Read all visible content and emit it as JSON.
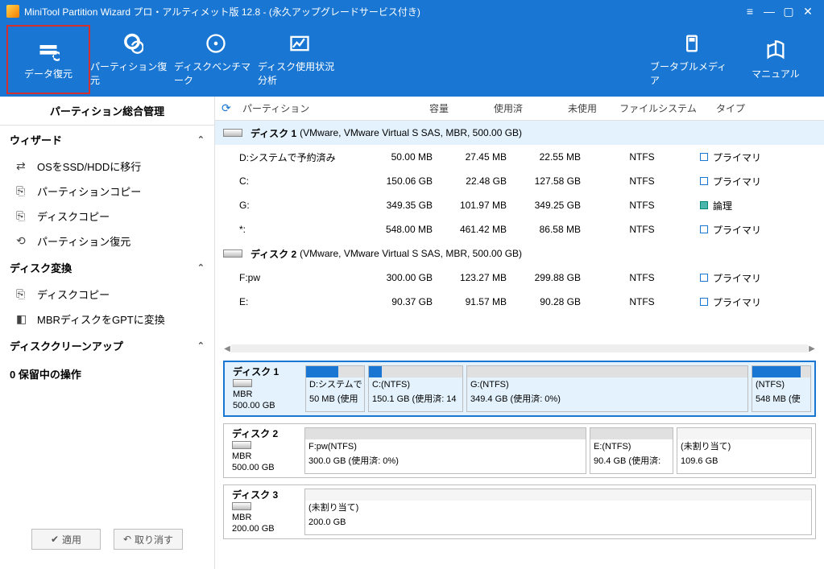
{
  "title": "MiniTool Partition Wizard プロ・アルティメット版 12.8 - (永久アップグレードサービス付き)",
  "ribbon": {
    "data_recovery": "データ復元",
    "partition_recovery": "パーティション復元",
    "disk_benchmark": "ディスクベンチマーク",
    "disk_usage": "ディスク使用状況分析",
    "bootable_media": "ブータブルメディア",
    "manual": "マニュアル"
  },
  "sidebar": {
    "tab": "パーティション総合管理",
    "wizard_head": "ウィザード",
    "wizard": {
      "os_migrate": "OSをSSD/HDDに移行",
      "partition_copy": "パーティションコピー",
      "disk_copy": "ディスクコピー",
      "partition_recovery": "パーティション復元"
    },
    "convert_head": "ディスク変換",
    "convert": {
      "disk_copy": "ディスクコピー",
      "mbr2gpt": "MBRディスクをGPTに変換"
    },
    "cleanup_head": "ディスククリーンアップ",
    "pending": "0 保留中の操作",
    "apply": "適用",
    "undo": "取り消す"
  },
  "columns": {
    "partition": "パーティション",
    "capacity": "容量",
    "used": "使用済",
    "unused": "未使用",
    "filesystem": "ファイルシステム",
    "type": "タイプ"
  },
  "types": {
    "primary": "プライマリ",
    "logical": "論理"
  },
  "disks": {
    "d1": {
      "name": "ディスク 1",
      "info": "(VMware, VMware Virtual S SAS, MBR, 500.00 GB)"
    },
    "d2": {
      "name": "ディスク 2",
      "info": "(VMware, VMware Virtual S SAS, MBR, 500.00 GB)"
    }
  },
  "rows": {
    "r1": {
      "p": "D:システムで予約済み",
      "c": "50.00 MB",
      "u": "27.45 MB",
      "f": "22.55 MB",
      "fs": "NTFS"
    },
    "r2": {
      "p": "C:",
      "c": "150.06 GB",
      "u": "22.48 GB",
      "f": "127.58 GB",
      "fs": "NTFS"
    },
    "r3": {
      "p": "G:",
      "c": "349.35 GB",
      "u": "101.97 MB",
      "f": "349.25 GB",
      "fs": "NTFS"
    },
    "r4": {
      "p": "*:",
      "c": "548.00 MB",
      "u": "461.42 MB",
      "f": "86.58 MB",
      "fs": "NTFS"
    },
    "r5": {
      "p": "F:pw",
      "c": "300.00 GB",
      "u": "123.27 MB",
      "f": "299.88 GB",
      "fs": "NTFS"
    },
    "r6": {
      "p": "E:",
      "c": "90.37 GB",
      "u": "91.57 MB",
      "f": "90.28 GB",
      "fs": "NTFS"
    }
  },
  "diagram": {
    "d1": {
      "title": "ディスク 1",
      "mbr": "MBR",
      "size": "500.00 GB",
      "p1": {
        "l1": "D:システムで",
        "l2": "50 MB (使用"
      },
      "p2": {
        "l1": "C:(NTFS)",
        "l2": "150.1 GB (使用済: 14"
      },
      "p3": {
        "l1": "G:(NTFS)",
        "l2": "349.4 GB (使用済: 0%)"
      },
      "p4": {
        "l1": "(NTFS)",
        "l2": "548 MB (使"
      }
    },
    "d2": {
      "title": "ディスク 2",
      "mbr": "MBR",
      "size": "500.00 GB",
      "p1": {
        "l1": "F:pw(NTFS)",
        "l2": "300.0 GB (使用済: 0%)"
      },
      "p2": {
        "l1": "E:(NTFS)",
        "l2": "90.4 GB (使用済:"
      },
      "p3": {
        "l1": "(未割り当て)",
        "l2": "109.6 GB"
      }
    },
    "d3": {
      "title": "ディスク 3",
      "mbr": "MBR",
      "size": "200.00 GB",
      "p1": {
        "l1": "(未割り当て)",
        "l2": "200.0 GB"
      }
    }
  }
}
